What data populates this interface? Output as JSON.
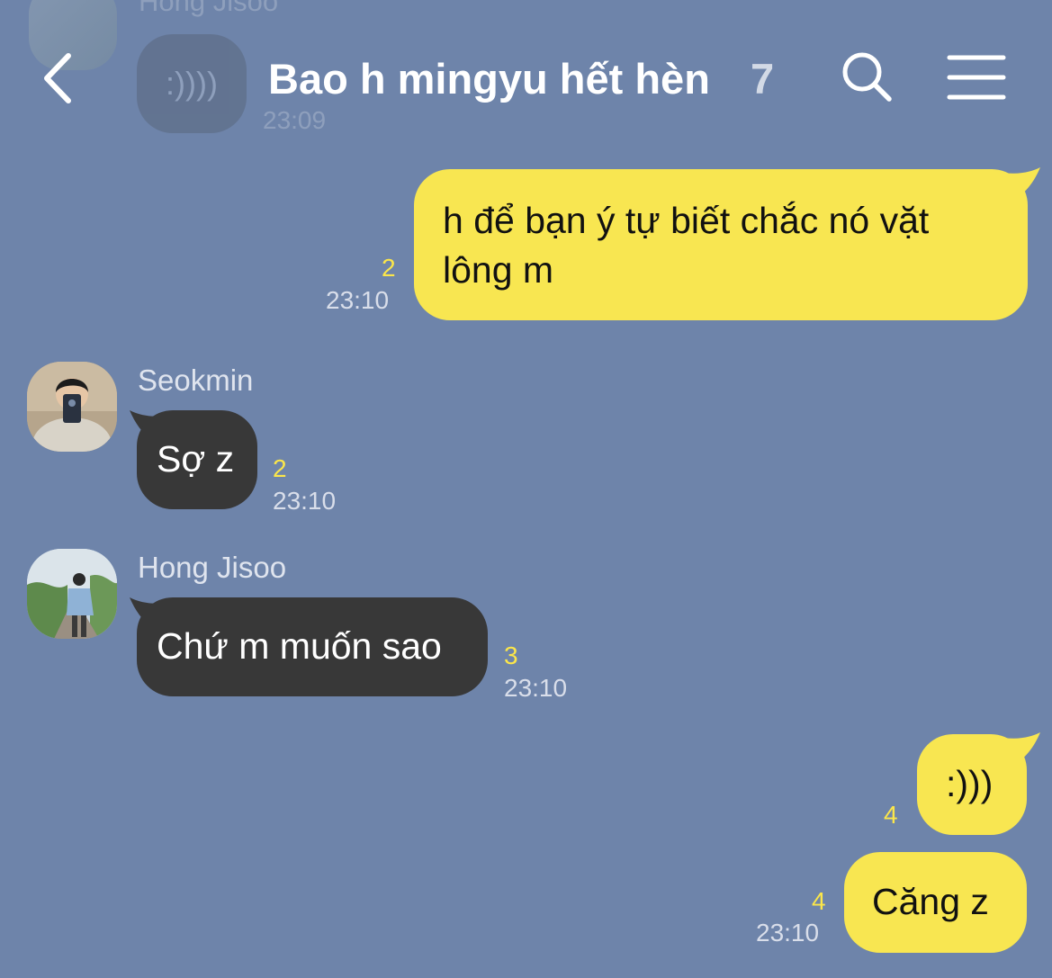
{
  "header": {
    "title": "Bao h mingyu hết hèn",
    "member_count": "7"
  },
  "previous_message": {
    "sender": "Hong Jisoo",
    "text": ":))))",
    "time": "23:09"
  },
  "messages": [
    {
      "direction": "outgoing",
      "text_line1": "h để bạn ý tự biết chắc nó vặt",
      "text_line2": "lông m",
      "unread": "2",
      "time": "23:10"
    },
    {
      "direction": "incoming",
      "sender": "Seokmin",
      "text": "Sợ z",
      "unread": "2",
      "time": "23:10"
    },
    {
      "direction": "incoming",
      "sender": "Hong Jisoo",
      "text": "Chứ m muốn sao",
      "unread": "3",
      "time": "23:10"
    },
    {
      "direction": "outgoing",
      "text": ":)))",
      "unread": "4"
    },
    {
      "direction": "outgoing",
      "text": "Căng z",
      "unread": "4",
      "time": "23:10"
    }
  ],
  "colors": {
    "background": "#6e84aa",
    "outgoing_bubble": "#f8e651",
    "incoming_bubble": "#383838",
    "unread_count": "#fbe64a"
  },
  "icons": {
    "back": "chevron-left-icon",
    "search": "search-icon",
    "menu": "hamburger-menu-icon"
  }
}
